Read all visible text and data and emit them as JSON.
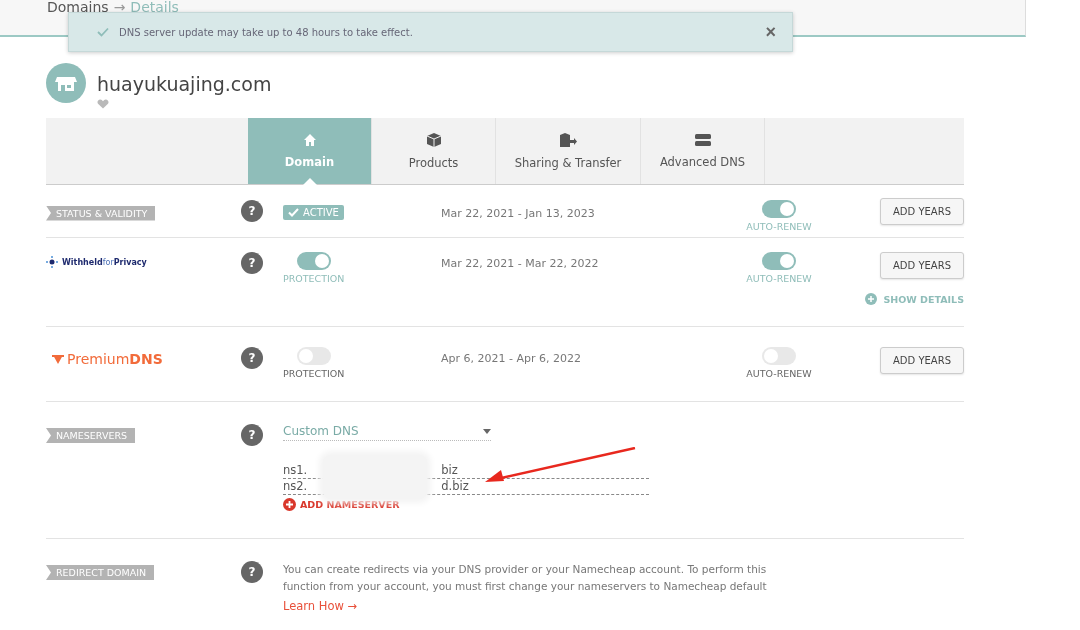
{
  "breadcrumb": {
    "parent": "Domains",
    "separator": "→",
    "current": "Details"
  },
  "toast": {
    "message": "DNS server update may take up to 48 hours to take effect.",
    "close": "×"
  },
  "domain": {
    "name": "huayukuajing.com"
  },
  "tabs": [
    {
      "label": "Domain",
      "selected": true
    },
    {
      "label": "Products",
      "selected": false
    },
    {
      "label": "Sharing & Transfer",
      "selected": false
    },
    {
      "label": "Advanced DNS",
      "selected": false
    }
  ],
  "rows": [
    {
      "kind": "status",
      "label": "STATUS & VALIDITY",
      "help": "?",
      "badge": "ACTIVE",
      "dates": "Mar 22, 2021 - Jan 13, 2023",
      "auto_renew": {
        "label": "AUTO-RENEW",
        "on": true
      },
      "button": "ADD YEARS"
    },
    {
      "kind": "privacy",
      "logo": [
        "Withheld",
        "for",
        "Privacy"
      ],
      "help": "?",
      "protection": {
        "label": "PROTECTION",
        "on": true
      },
      "dates": "Mar 22, 2021 - Mar 22, 2022",
      "auto_renew": {
        "label": "AUTO-RENEW",
        "on": true
      },
      "button": "ADD YEARS",
      "details_link": "SHOW DETAILS"
    },
    {
      "kind": "premium_dns",
      "logo": [
        "Premium",
        "DNS"
      ],
      "help": "?",
      "protection": {
        "label": "PROTECTION",
        "on": false
      },
      "dates": "Apr 6, 2021 - Apr 6, 2022",
      "auto_renew": {
        "label": "AUTO-RENEW",
        "on": false
      },
      "button": "ADD YEARS"
    },
    {
      "kind": "nameservers",
      "label": "NAMESERVERS",
      "help": "?",
      "select": "Custom DNS",
      "nameservers": [
        {
          "start": "ns1.",
          "end": "biz"
        },
        {
          "start": "ns2.",
          "end": "d.biz"
        }
      ],
      "add_link": "ADD NAMESERVER"
    },
    {
      "kind": "redirect",
      "label": "REDIRECT DOMAIN",
      "help": "?",
      "text": "You can create redirects via your DNS provider or your Namecheap account. To perform this function from your account, you must first change your nameservers to Namecheap default",
      "link": "Learn How →"
    }
  ]
}
